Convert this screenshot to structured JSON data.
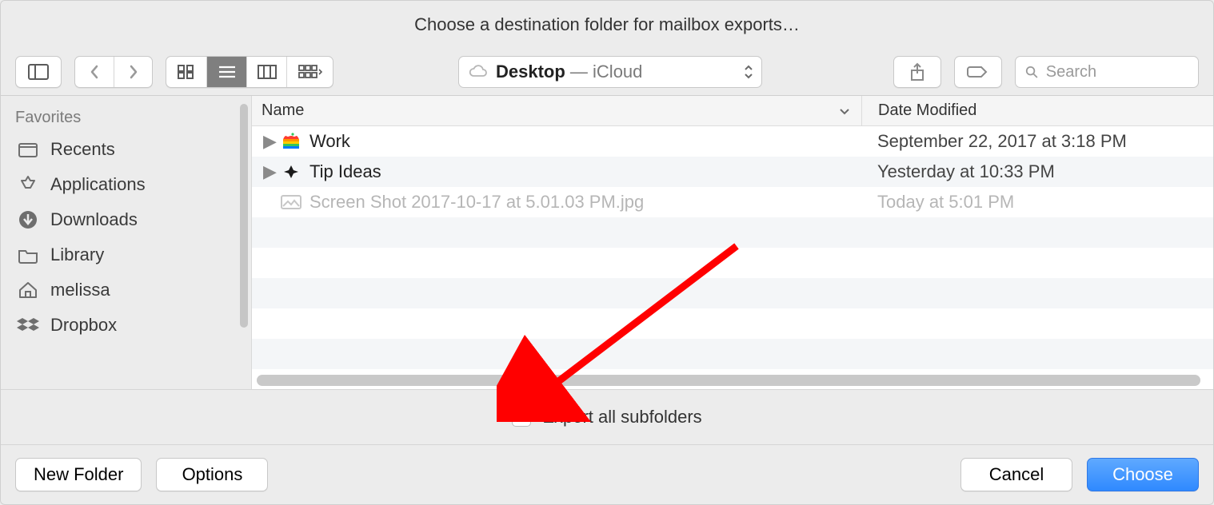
{
  "dialog": {
    "title": "Choose a destination folder for mailbox exports…"
  },
  "toolbar": {
    "location_primary": "Desktop",
    "location_separator": " — ",
    "location_secondary": "iCloud",
    "search_placeholder": "Search"
  },
  "sidebar": {
    "section": "Favorites",
    "items": [
      {
        "label": "Recents",
        "icon": "recents"
      },
      {
        "label": "Applications",
        "icon": "applications"
      },
      {
        "label": "Downloads",
        "icon": "downloads"
      },
      {
        "label": "Library",
        "icon": "folder"
      },
      {
        "label": "melissa",
        "icon": "home"
      },
      {
        "label": "Dropbox",
        "icon": "dropbox"
      }
    ]
  },
  "columns": {
    "name": "Name",
    "date": "Date Modified"
  },
  "rows": [
    {
      "name": "Work",
      "date": "September 22, 2017 at 3:18 PM",
      "kind": "folder",
      "icon": "apple-rainbow",
      "disabled": false
    },
    {
      "name": "Tip Ideas",
      "date": "Yesterday at 10:33 PM",
      "kind": "folder",
      "icon": "sparkle",
      "disabled": false
    },
    {
      "name": "Screen Shot 2017-10-17 at 5.01.03 PM.jpg",
      "date": "Today at 5:01 PM",
      "kind": "file",
      "icon": "image",
      "disabled": true
    }
  ],
  "options": {
    "export_all_label": "Export all subfolders",
    "export_all_checked": false
  },
  "actions": {
    "new_folder": "New Folder",
    "options": "Options",
    "cancel": "Cancel",
    "choose": "Choose"
  },
  "annotation": {
    "arrow_color": "#ff0000"
  }
}
